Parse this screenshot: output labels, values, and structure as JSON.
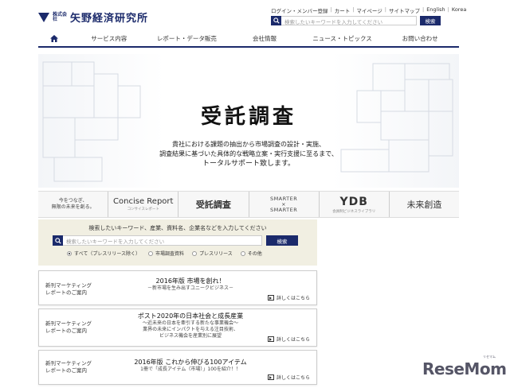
{
  "header": {
    "logo_small": "株式会社",
    "logo_text": "矢野経済研究所",
    "top_links": [
      "ログイン・メンバー登録",
      "カート",
      "マイページ",
      "サイトマップ",
      "English",
      "Korea"
    ],
    "search_placeholder": "検索したいキーワードを入力してください",
    "search_button": "検索"
  },
  "nav": {
    "items": [
      "サービス内容",
      "レポート・データ販売",
      "会社情報",
      "ニュース・トピックス",
      "お問い合わせ"
    ]
  },
  "hero": {
    "title": "受託調査",
    "line1": "貴社における課題の抽出から市場調査の設計・実施、",
    "line2": "調査結果に基づいた具体的な戦略立案・実行支援に至るまで、",
    "line3": "トータルサポート致します。"
  },
  "banners": {
    "b1_line1": "今をつなぎ、",
    "b1_line2": "無限の未来を創る。",
    "b2_main": "Concise Report",
    "b2_sub": "コンサイスレポート",
    "b3_main": "受託調査",
    "b4_line1": "SMARTER",
    "b4_line2": "×",
    "b4_line3": "SMARTER",
    "b5_main": "YDB",
    "b5_sub": "会員制ビジネスライブラリ",
    "b6_main": "未来創造"
  },
  "search_section": {
    "prompt": "検索したいキーワード、産業、資料名、企業名などを入力してください",
    "placeholder": "検索したいキーワードを入力してください",
    "button": "検索",
    "options": [
      "すべて（プレスリリース除く）",
      "市場調査資料",
      "プレスリリース",
      "その他"
    ],
    "selected_index": 0
  },
  "cards": [
    {
      "left1": "新刊マーケティング",
      "left2": "レポートのご案内",
      "title": "2016年版 市場を創れ！",
      "subs": [
        "－新市場を生み出すユニークビジネス－"
      ],
      "more": "詳しくはこちら"
    },
    {
      "left1": "新刊マーケティング",
      "left2": "レポートのご案内",
      "title": "ポスト2020年の日本社会と成長産業",
      "subs": [
        "～近未来の日本を牽引する新たな事業機会～",
        "業界の未来にインパクトを与える注目技術、",
        "ビジネス機会を産業別に展望"
      ],
      "more": "詳しくはこちら"
    },
    {
      "left1": "新刊マーケティング",
      "left2": "レポートのご案内",
      "title": "2016年版 これから伸びる100アイテム",
      "subs": [
        "1冊で「成長アイテム（市場）」100を紹介！！"
      ],
      "more": "詳しくはこちら"
    }
  ],
  "watermark": {
    "text": "ReseMom",
    "small": "リセマム"
  }
}
